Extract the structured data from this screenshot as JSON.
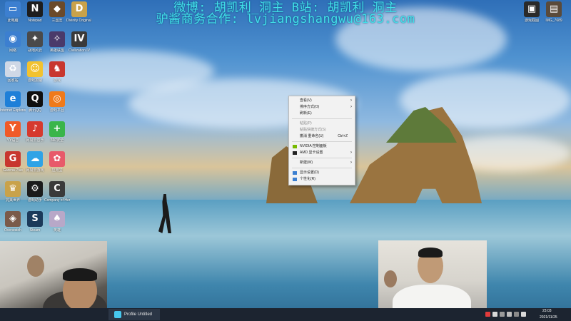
{
  "overlay": {
    "line1": "微博: 胡凯利_洞主 B站: 胡凯利_洞主",
    "line2": "驴酱商务合作: lvjiangshangwu@163.com"
  },
  "desktop_icons_left": [
    {
      "label": "此电脑",
      "icon": "computer-icon",
      "color": "#3c7fd0",
      "glyph": "▭"
    },
    {
      "label": "Notepad",
      "icon": "n-app-icon",
      "color": "#1d1d1d",
      "glyph": "N"
    },
    {
      "label": "三国志",
      "icon": "game-icon",
      "color": "#6b4a2a",
      "glyph": "◆"
    },
    {
      "label": "Divinity Original Sin",
      "icon": "d-app-icon",
      "color": "#c9a24a",
      "glyph": "D"
    },
    {
      "label": "网络",
      "icon": "network-icon",
      "color": "#3c7fd0",
      "glyph": "◉"
    },
    {
      "label": "战地风云",
      "icon": "game-icon",
      "color": "#4a4a4a",
      "glyph": "✦"
    },
    {
      "label": "英雄联盟",
      "icon": "game-icon",
      "color": "#4a3a6a",
      "glyph": "✧"
    },
    {
      "label": "Civilization IV",
      "icon": "civ-icon",
      "color": "#3a3a3a",
      "glyph": "IV"
    },
    {
      "label": "回收站",
      "icon": "recycle-bin-icon",
      "color": "#cfd8e6",
      "glyph": "♻"
    },
    {
      "label": "游戏加速",
      "icon": "game-icon",
      "color": "#f2c230",
      "glyph": "☺"
    },
    {
      "label": "游戏",
      "icon": "game-icon",
      "color": "#c8372f",
      "glyph": "♞"
    },
    {
      "label": "Internet Explorer",
      "icon": "ie-icon",
      "color": "#1e7fd8",
      "glyph": "e"
    },
    {
      "label": "腾讯QQ",
      "icon": "qq-icon",
      "color": "#101010",
      "glyph": "Q"
    },
    {
      "label": "游戏平台",
      "icon": "game-icon",
      "color": "#f07a1a",
      "glyph": "◎"
    },
    {
      "label": "YY语音",
      "icon": "yy-icon",
      "color": "#f05a28",
      "glyph": "Y"
    },
    {
      "label": "网易云音乐",
      "icon": "music-icon",
      "color": "#d63a2f",
      "glyph": "♪"
    },
    {
      "label": "360安全",
      "icon": "shield-icon",
      "color": "#3ab54a",
      "glyph": "+"
    },
    {
      "label": "Garena Plus",
      "icon": "game-icon",
      "color": "#c8372f",
      "glyph": "G"
    },
    {
      "label": "网易云游戏",
      "icon": "cloud-icon",
      "color": "#2fa3e6",
      "glyph": "☁"
    },
    {
      "label": "应用宝",
      "icon": "app-store-icon",
      "color": "#e85a6a",
      "glyph": "✿"
    },
    {
      "label": "完美世界",
      "icon": "game-icon",
      "color": "#c9a24a",
      "glyph": "♛"
    },
    {
      "label": "游戏助手",
      "icon": "game-icon",
      "color": "#1b1b1b",
      "glyph": "⚙"
    },
    {
      "label": "Company of Heroes 2",
      "icon": "coh2-icon",
      "color": "#3a3a3a",
      "glyph": "C"
    },
    {
      "label": "Overwatch",
      "icon": "game-icon",
      "color": "#7a5a4a",
      "glyph": "◈"
    },
    {
      "label": "Steam",
      "icon": "steam-icon",
      "color": "#1b3a5a",
      "glyph": "S"
    },
    {
      "label": "英雄",
      "icon": "game-icon",
      "color": "#b8a8c8",
      "glyph": "♠"
    }
  ],
  "desktop_icons_right": [
    {
      "label": "游戏截图",
      "icon": "folder-icon",
      "color": "#2a2a2a",
      "glyph": "▣"
    },
    {
      "label": "IMG_7689",
      "icon": "image-icon",
      "color": "#5a4a3a",
      "glyph": "▤"
    }
  ],
  "context_menu": {
    "items": [
      {
        "label": "查看(V)",
        "submenu": true,
        "disabled": false,
        "shortcut": "",
        "icon": ""
      },
      {
        "label": "排序方式(O)",
        "submenu": true,
        "disabled": false,
        "shortcut": "",
        "icon": ""
      },
      {
        "label": "刷新(E)",
        "submenu": false,
        "disabled": false,
        "shortcut": "",
        "icon": ""
      },
      {
        "label": "粘贴(P)",
        "submenu": false,
        "disabled": true,
        "shortcut": "",
        "icon": ""
      },
      {
        "label": "粘贴快捷方式(S)",
        "submenu": false,
        "disabled": true,
        "shortcut": "",
        "icon": ""
      },
      {
        "label": "撤消 重命名(U)",
        "submenu": false,
        "disabled": false,
        "shortcut": "Ctrl+Z",
        "icon": ""
      },
      {
        "label": "NVIDIA 控制面板",
        "submenu": false,
        "disabled": false,
        "shortcut": "",
        "icon": "nvidia-icon"
      },
      {
        "label": "AMD 显卡设置",
        "submenu": true,
        "disabled": false,
        "shortcut": "",
        "icon": "amd-icon"
      },
      {
        "label": "新建(W)",
        "submenu": true,
        "disabled": false,
        "shortcut": "",
        "icon": ""
      },
      {
        "label": "显示设置(D)",
        "submenu": false,
        "disabled": false,
        "shortcut": "",
        "icon": "display-icon"
      },
      {
        "label": "个性化(R)",
        "submenu": false,
        "disabled": false,
        "shortcut": "",
        "icon": "personalize-icon"
      }
    ]
  },
  "taskbar": {
    "window_title": "Profile Untitled",
    "time": "23:03",
    "date": "2021/11/25"
  },
  "colors": {
    "overlay_text": "#42e0e8",
    "menu_bg": "#f2f2f2",
    "taskbar": "#1c2430"
  }
}
